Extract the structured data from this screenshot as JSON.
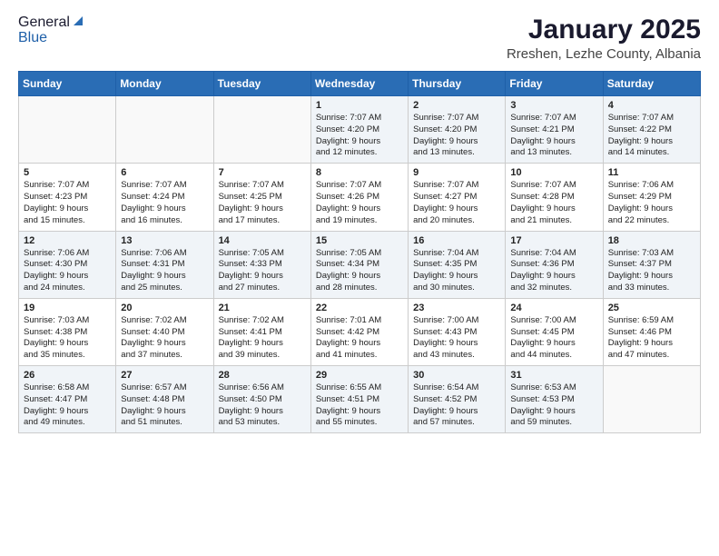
{
  "logo": {
    "general": "General",
    "blue": "Blue"
  },
  "title": "January 2025",
  "subtitle": "Rreshen, Lezhe County, Albania",
  "days_header": [
    "Sunday",
    "Monday",
    "Tuesday",
    "Wednesday",
    "Thursday",
    "Friday",
    "Saturday"
  ],
  "weeks": [
    [
      {
        "day": "",
        "content": ""
      },
      {
        "day": "",
        "content": ""
      },
      {
        "day": "",
        "content": ""
      },
      {
        "day": "1",
        "content": "Sunrise: 7:07 AM\nSunset: 4:20 PM\nDaylight: 9 hours\nand 12 minutes."
      },
      {
        "day": "2",
        "content": "Sunrise: 7:07 AM\nSunset: 4:20 PM\nDaylight: 9 hours\nand 13 minutes."
      },
      {
        "day": "3",
        "content": "Sunrise: 7:07 AM\nSunset: 4:21 PM\nDaylight: 9 hours\nand 13 minutes."
      },
      {
        "day": "4",
        "content": "Sunrise: 7:07 AM\nSunset: 4:22 PM\nDaylight: 9 hours\nand 14 minutes."
      }
    ],
    [
      {
        "day": "5",
        "content": "Sunrise: 7:07 AM\nSunset: 4:23 PM\nDaylight: 9 hours\nand 15 minutes."
      },
      {
        "day": "6",
        "content": "Sunrise: 7:07 AM\nSunset: 4:24 PM\nDaylight: 9 hours\nand 16 minutes."
      },
      {
        "day": "7",
        "content": "Sunrise: 7:07 AM\nSunset: 4:25 PM\nDaylight: 9 hours\nand 17 minutes."
      },
      {
        "day": "8",
        "content": "Sunrise: 7:07 AM\nSunset: 4:26 PM\nDaylight: 9 hours\nand 19 minutes."
      },
      {
        "day": "9",
        "content": "Sunrise: 7:07 AM\nSunset: 4:27 PM\nDaylight: 9 hours\nand 20 minutes."
      },
      {
        "day": "10",
        "content": "Sunrise: 7:07 AM\nSunset: 4:28 PM\nDaylight: 9 hours\nand 21 minutes."
      },
      {
        "day": "11",
        "content": "Sunrise: 7:06 AM\nSunset: 4:29 PM\nDaylight: 9 hours\nand 22 minutes."
      }
    ],
    [
      {
        "day": "12",
        "content": "Sunrise: 7:06 AM\nSunset: 4:30 PM\nDaylight: 9 hours\nand 24 minutes."
      },
      {
        "day": "13",
        "content": "Sunrise: 7:06 AM\nSunset: 4:31 PM\nDaylight: 9 hours\nand 25 minutes."
      },
      {
        "day": "14",
        "content": "Sunrise: 7:05 AM\nSunset: 4:33 PM\nDaylight: 9 hours\nand 27 minutes."
      },
      {
        "day": "15",
        "content": "Sunrise: 7:05 AM\nSunset: 4:34 PM\nDaylight: 9 hours\nand 28 minutes."
      },
      {
        "day": "16",
        "content": "Sunrise: 7:04 AM\nSunset: 4:35 PM\nDaylight: 9 hours\nand 30 minutes."
      },
      {
        "day": "17",
        "content": "Sunrise: 7:04 AM\nSunset: 4:36 PM\nDaylight: 9 hours\nand 32 minutes."
      },
      {
        "day": "18",
        "content": "Sunrise: 7:03 AM\nSunset: 4:37 PM\nDaylight: 9 hours\nand 33 minutes."
      }
    ],
    [
      {
        "day": "19",
        "content": "Sunrise: 7:03 AM\nSunset: 4:38 PM\nDaylight: 9 hours\nand 35 minutes."
      },
      {
        "day": "20",
        "content": "Sunrise: 7:02 AM\nSunset: 4:40 PM\nDaylight: 9 hours\nand 37 minutes."
      },
      {
        "day": "21",
        "content": "Sunrise: 7:02 AM\nSunset: 4:41 PM\nDaylight: 9 hours\nand 39 minutes."
      },
      {
        "day": "22",
        "content": "Sunrise: 7:01 AM\nSunset: 4:42 PM\nDaylight: 9 hours\nand 41 minutes."
      },
      {
        "day": "23",
        "content": "Sunrise: 7:00 AM\nSunset: 4:43 PM\nDaylight: 9 hours\nand 43 minutes."
      },
      {
        "day": "24",
        "content": "Sunrise: 7:00 AM\nSunset: 4:45 PM\nDaylight: 9 hours\nand 44 minutes."
      },
      {
        "day": "25",
        "content": "Sunrise: 6:59 AM\nSunset: 4:46 PM\nDaylight: 9 hours\nand 47 minutes."
      }
    ],
    [
      {
        "day": "26",
        "content": "Sunrise: 6:58 AM\nSunset: 4:47 PM\nDaylight: 9 hours\nand 49 minutes."
      },
      {
        "day": "27",
        "content": "Sunrise: 6:57 AM\nSunset: 4:48 PM\nDaylight: 9 hours\nand 51 minutes."
      },
      {
        "day": "28",
        "content": "Sunrise: 6:56 AM\nSunset: 4:50 PM\nDaylight: 9 hours\nand 53 minutes."
      },
      {
        "day": "29",
        "content": "Sunrise: 6:55 AM\nSunset: 4:51 PM\nDaylight: 9 hours\nand 55 minutes."
      },
      {
        "day": "30",
        "content": "Sunrise: 6:54 AM\nSunset: 4:52 PM\nDaylight: 9 hours\nand 57 minutes."
      },
      {
        "day": "31",
        "content": "Sunrise: 6:53 AM\nSunset: 4:53 PM\nDaylight: 9 hours\nand 59 minutes."
      },
      {
        "day": "",
        "content": ""
      }
    ]
  ]
}
